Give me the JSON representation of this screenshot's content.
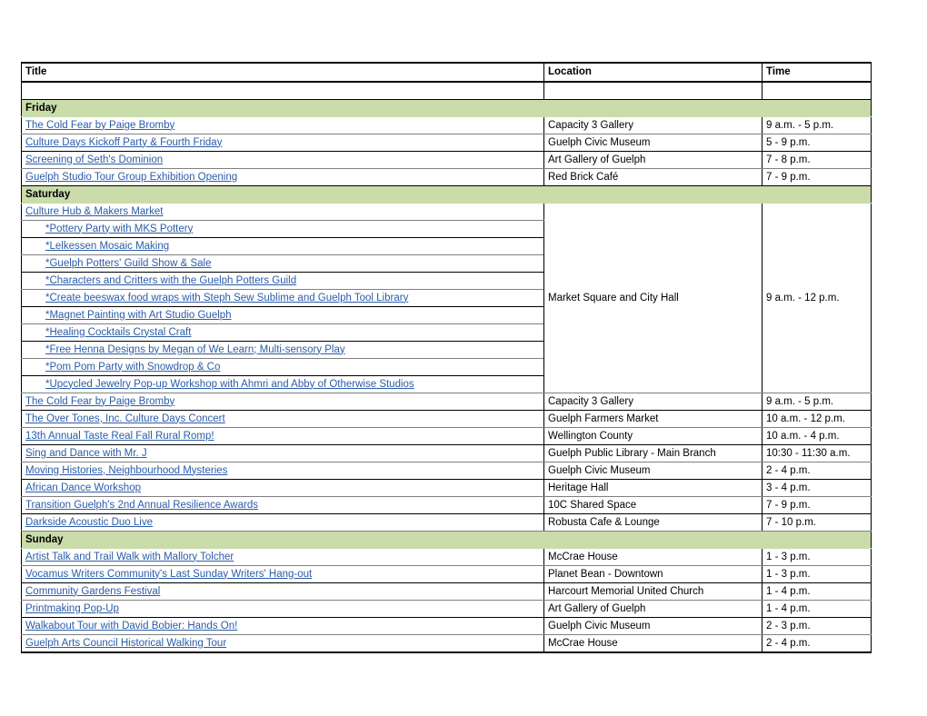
{
  "table": {
    "columns": [
      "Title",
      "Location",
      "Time"
    ],
    "blank_row": {
      "title": "",
      "location": "",
      "time": ""
    },
    "sections": [
      {
        "day": "Friday",
        "rows": [
          {
            "title": "The Cold Fear by Paige Bromby",
            "location": "Capacity 3 Gallery",
            "time": "9 a.m. - 5 p.m.",
            "link": true,
            "indent": false
          },
          {
            "title": "Culture Days Kickoff Party & Fourth Friday",
            "location": "Guelph Civic Museum",
            "time": "5 - 9 p.m.",
            "link": true,
            "indent": false
          },
          {
            "title": "Screening of Seth's Dominion",
            "location": "Art Gallery of Guelph",
            "time": "7 - 8 p.m.",
            "link": true,
            "indent": false
          },
          {
            "title": "Guelph Studio Tour Group Exhibition Opening",
            "location": "Red Brick Café",
            "time": "7 - 9 p.m.",
            "link": true,
            "indent": false
          }
        ]
      },
      {
        "day": "Saturday",
        "merged_block": {
          "location": "Market Square and City Hall",
          "time": "9 a.m. - 12 p.m.",
          "rows": [
            {
              "title": "Culture Hub & Makers Market",
              "link": true,
              "indent": false
            },
            {
              "title": "*Pottery Party with MKS Pottery",
              "link": true,
              "indent": true
            },
            {
              "title": "*Lelkessen Mosaic Making",
              "link": true,
              "indent": true
            },
            {
              "title": "*Guelph Potters' Guild Show & Sale",
              "link": true,
              "indent": true
            },
            {
              "title": "*Characters and Critters with the Guelph Potters Guild",
              "link": true,
              "indent": true
            },
            {
              "title": "*Create beeswax food wraps with Steph Sew Sublime and Guelph Tool Library",
              "link": true,
              "indent": true
            },
            {
              "title": "*Magnet Painting with Art Studio Guelph",
              "link": true,
              "indent": true
            },
            {
              "title": "*Healing Cocktails Crystal Craft",
              "link": true,
              "indent": true
            },
            {
              "title": "*Free Henna Designs by Megan of We Learn; Multi-sensory Play",
              "link": true,
              "indent": true
            },
            {
              "title": "*Pom Pom Party with Snowdrop & Co",
              "link": true,
              "indent": true
            },
            {
              "title": "*Upcycled Jewelry Pop-up Workshop with Ahmri and Abby of Otherwise Studios",
              "link": true,
              "indent": true
            }
          ]
        },
        "rows": [
          {
            "title": "The Cold Fear by Paige Bromby",
            "location": "Capacity 3 Gallery",
            "time": "9 a.m. - 5 p.m.",
            "link": true,
            "indent": false
          },
          {
            "title": "The Over Tones, Inc. Culture Days Concert",
            "location": "Guelph Farmers Market",
            "time": "10 a.m. - 12 p.m.",
            "link": true,
            "indent": false
          },
          {
            "title": "13th Annual Taste Real Fall Rural Romp!",
            "location": "Wellington County",
            "time": "10 a.m. - 4 p.m.",
            "link": true,
            "indent": false
          },
          {
            "title": "Sing and Dance with Mr. J",
            "location": "Guelph Public Library - Main Branch",
            "time": "10:30 - 11:30 a.m.",
            "link": true,
            "indent": false
          },
          {
            "title": "Moving Histories, Neighbourhood Mysteries",
            "location": "Guelph Civic Museum",
            "time": "2 - 4 p.m.",
            "link": true,
            "indent": false
          },
          {
            "title": "African Dance Workshop",
            "location": "Heritage Hall",
            "time": "3 - 4 p.m.",
            "link": true,
            "indent": false
          },
          {
            "title": "Transition Guelph's 2nd Annual Resilience Awards",
            "location": "10C Shared Space",
            "time": "7 - 9 p.m.",
            "link": true,
            "indent": false
          },
          {
            "title": "Darkside Acoustic Duo Live",
            "location": "Robusta Cafe & Lounge",
            "time": "7 - 10 p.m.",
            "link": true,
            "indent": false
          }
        ]
      },
      {
        "day": "Sunday",
        "rows": [
          {
            "title": "Artist Talk and Trail Walk with Mallory Tolcher",
            "location": "McCrae House",
            "time": "1 - 3 p.m.",
            "link": true,
            "indent": false
          },
          {
            "title": "Vocamus Writers Community's Last Sunday Writers' Hang-out",
            "location": "Planet Bean - Downtown",
            "time": "1 - 3 p.m.",
            "link": true,
            "indent": false
          },
          {
            "title": "Community Gardens Festival",
            "location": "Harcourt Memorial United Church",
            "time": "1 - 4 p.m.",
            "link": true,
            "indent": false
          },
          {
            "title": "Printmaking Pop-Up",
            "location": "Art Gallery of Guelph",
            "time": "1 - 4 p.m.",
            "link": true,
            "indent": false
          },
          {
            "title": "Walkabout Tour with David Bobier: Hands On!",
            "location": "Guelph Civic Museum",
            "time": "2 - 3 p.m.",
            "link": true,
            "indent": false
          },
          {
            "title": "Guelph Arts Council Historical Walking Tour",
            "location": "McCrae House",
            "time": "2 - 4 p.m.",
            "link": true,
            "indent": false
          }
        ]
      }
    ]
  },
  "colors": {
    "day_header_background": "#c9dcaa",
    "link": "#2b5ca8",
    "text": "#000000",
    "border": "#000000",
    "border_light": "#808080",
    "page_background": "#ffffff"
  }
}
